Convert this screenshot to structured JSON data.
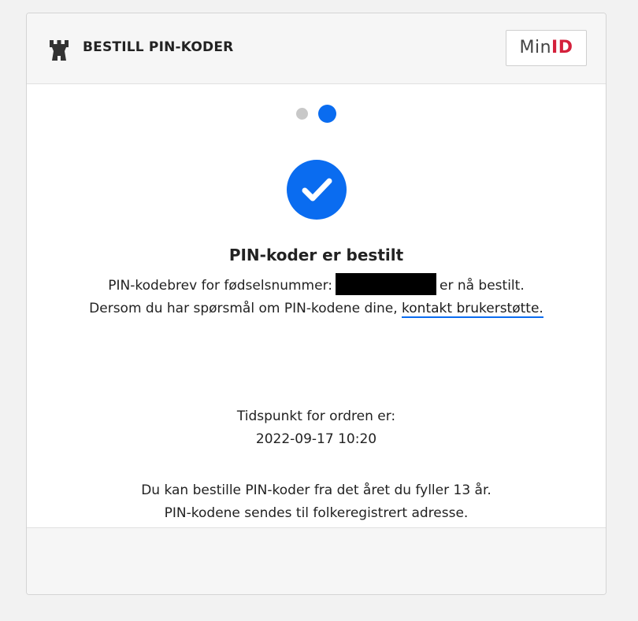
{
  "header": {
    "title": "BESTILL PIN-KODER",
    "logo_min": "Min",
    "logo_id": "ID",
    "icon": "castle-icon"
  },
  "stepper": {
    "steps": 2,
    "current_step": 2,
    "active_color": "#0a6cf0",
    "inactive_color": "#c8c8c8"
  },
  "status": {
    "icon": "checkmark-icon",
    "heading": "PIN-koder er bestilt"
  },
  "message": {
    "prefix": "PIN-kodebrev for fødselsnummer:",
    "suffix": "er nå bestilt.",
    "support_text": "Dersom du har spørsmål om PIN-kodene dine,",
    "support_link": "kontakt brukerstøtte."
  },
  "order": {
    "label": "Tidspunkt for ordren er:",
    "timestamp": "2022-09-17 10:20"
  },
  "info": {
    "line1": "Du kan bestille PIN-koder fra det året du fyller 13 år.",
    "line2": "PIN-kodene sendes til folkeregistrert adresse."
  },
  "colors": {
    "accent": "#0a6cf0",
    "brand_red": "#d4203b"
  }
}
